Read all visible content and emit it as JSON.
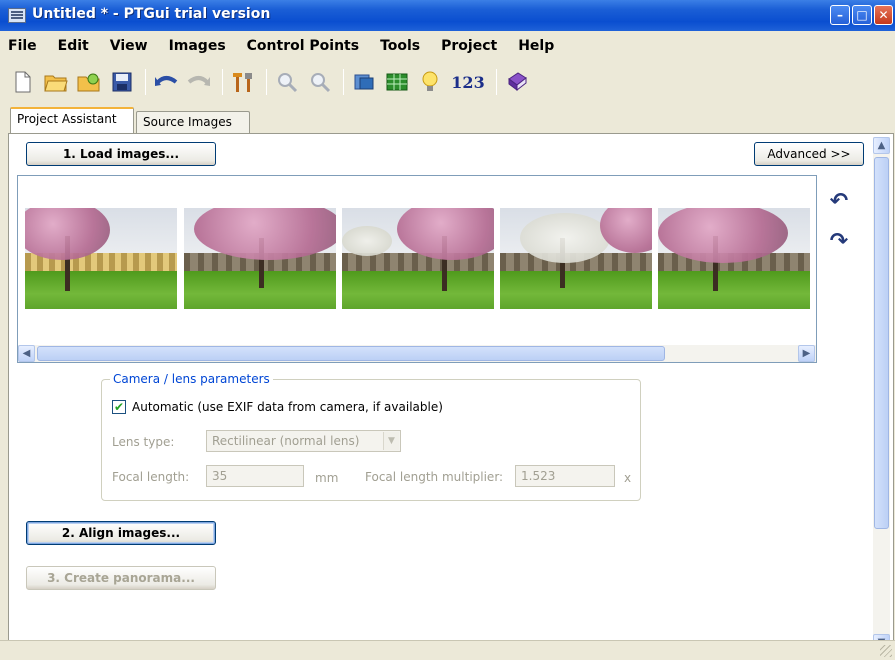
{
  "window": {
    "title": "Untitled * - PTGui trial version"
  },
  "menu": [
    "File",
    "Edit",
    "View",
    "Images",
    "Control Points",
    "Tools",
    "Project",
    "Help"
  ],
  "toolbar": {
    "numbering_label": "123",
    "icons": [
      "new-document-icon",
      "open-folder-icon",
      "open-recent-icon",
      "save-icon",
      "undo-icon",
      "redo-icon",
      "tools-icon",
      "zoom-in-icon",
      "zoom-out-icon",
      "panorama-editor-icon",
      "control-points-table-icon",
      "lightbulb-icon",
      "numbering-icon",
      "help-book-icon"
    ]
  },
  "tabs": [
    "Project Assistant",
    "Source Images"
  ],
  "assistant": {
    "load_button": "1. Load images...",
    "advanced_button": "Advanced >>",
    "align_button": "2. Align images...",
    "create_button": "3. Create panorama..."
  },
  "camera": {
    "group_label": "Camera / lens parameters",
    "automatic_label": "Automatic (use EXIF data from camera, if available)",
    "automatic_checked": true,
    "lens_type_label": "Lens type:",
    "lens_type_value": "Rectilinear (normal lens)",
    "focal_length_label": "Focal length:",
    "focal_length_value": "35",
    "focal_length_unit": "mm",
    "multiplier_label": "Focal length multiplier:",
    "multiplier_value": "1.523",
    "multiplier_unit": "x"
  },
  "thumbnails": [
    "Image 1",
    "Image 2",
    "Image 3",
    "Image 4",
    "Image 5"
  ]
}
